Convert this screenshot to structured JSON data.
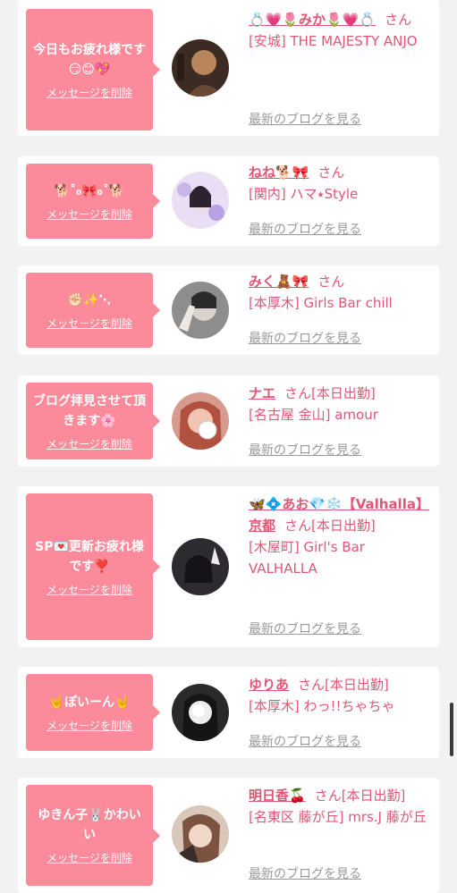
{
  "delete_label": "メッセージを削除",
  "blog_label": "最新のブログを見る",
  "san_suffix": "さん",
  "colors": {
    "bubble": "#fb8b9a",
    "accent": "#e25675",
    "muted": "#999999"
  },
  "items": [
    {
      "message": "今日もお疲れ様です😏😊💖",
      "name": "💍💗🌷みか🌷💗💍",
      "status": "",
      "shop": "[安城] THE MAJESTY ANJO"
    },
    {
      "message": "🐕˚₀🎀₀˚🐕",
      "name": "ねね🐕🎀",
      "status": "",
      "shop": "[関内] ハマ⭑Style"
    },
    {
      "message": "✊🏻✨⋱",
      "name": "みく🧸🎀",
      "status": "",
      "shop": "[本厚木] Girls Bar chill"
    },
    {
      "message": "ブログ拝見させて頂きます🌸",
      "name": "ナエ",
      "status": "[本日出勤]",
      "shop": "[名古屋 金山] amour"
    },
    {
      "message": "SP💌更新お疲れ様です❣️",
      "name": "🦋💠あお💎❄️【Valhalla】京都",
      "status": "[本日出勤]",
      "shop": "[木屋町] Girl's Bar VALHALLA"
    },
    {
      "message": "🤘ぽいーん🤘",
      "name": "ゆりあ",
      "status": "[本日出勤]",
      "shop": "[本厚木] わっ!!ちゃちゃ"
    },
    {
      "message": "ゆきん子🐰かわいい",
      "name": "明日香🍒",
      "status": "[本日出勤]",
      "shop": "[名東区 藤が丘] mrs.J 藤が丘"
    }
  ]
}
